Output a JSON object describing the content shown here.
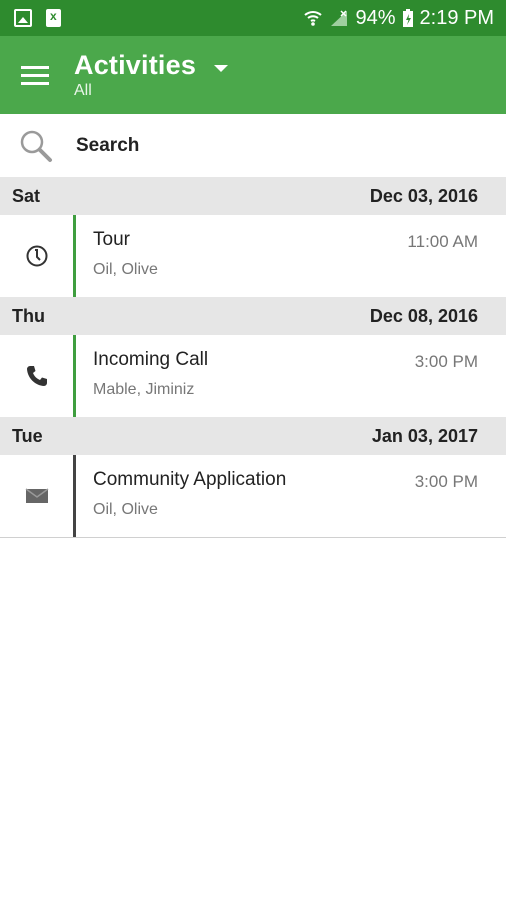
{
  "status_bar": {
    "battery": "94%",
    "time": "2:19 PM",
    "icons": [
      "image-notification-icon",
      "document-notification-icon",
      "wifi-icon",
      "signal-icon",
      "battery-icon"
    ]
  },
  "app_bar": {
    "title": "Activities",
    "subtitle": "All",
    "colors": {
      "status_bar": "#2e8b2e",
      "app_bar": "#4ba84b"
    }
  },
  "search": {
    "label": "Search"
  },
  "groups": [
    {
      "day": "Sat",
      "date": "Dec 03, 2016",
      "items": [
        {
          "icon": "clock-icon",
          "name": "Tour",
          "people": "Oil, Olive",
          "time": "11:00 AM",
          "accent": "#3f9e3f"
        }
      ]
    },
    {
      "day": "Thu",
      "date": "Dec 08, 2016",
      "items": [
        {
          "icon": "phone-icon",
          "name": "Incoming Call",
          "people": "Mable, Jiminiz",
          "time": "3:00 PM",
          "accent": "#3f9e3f"
        }
      ]
    },
    {
      "day": "Tue",
      "date": "Jan 03, 2017",
      "items": [
        {
          "icon": "mail-icon",
          "name": "Community Application",
          "people": "Oil, Olive",
          "time": "3:00 PM",
          "accent": "#444444"
        }
      ]
    }
  ]
}
